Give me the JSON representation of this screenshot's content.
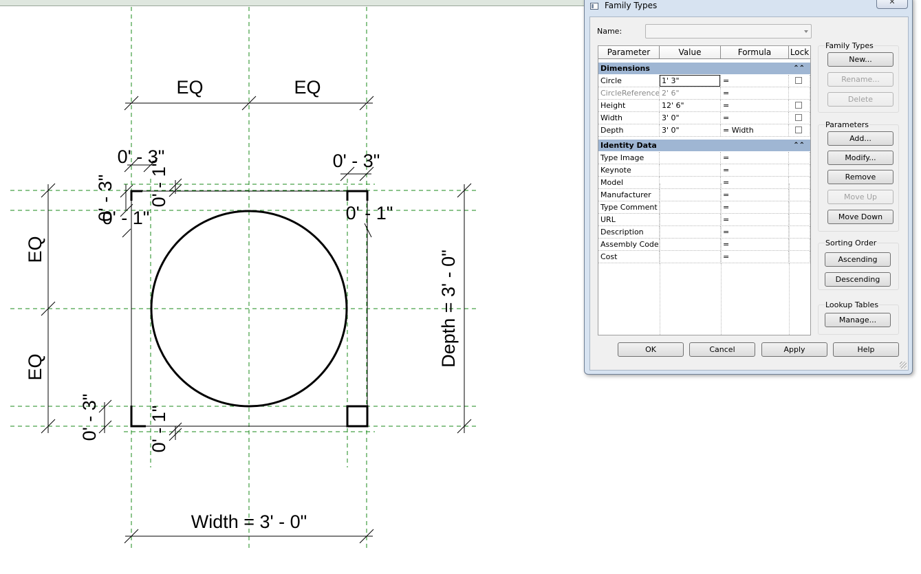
{
  "drawing": {
    "dim_labels": {
      "eq_top_left": "EQ",
      "eq_top_right": "EQ",
      "eq_left_top": "EQ",
      "eq_left_bottom": "EQ",
      "offset_top_left": "0' - 3\"",
      "offset_top_right": "0' - 3\"",
      "offset_left_top": "0' - 3\"",
      "offset_left_small": "0' - 1\"",
      "offset_vert_top_left": "0' - 1\"",
      "offset_right_small": "0' - 1\"",
      "offset_bottom_left": "0' - 3\"",
      "offset_bottom_vert": "0' - 1\"",
      "depth": "Depth = 3' - 0\"",
      "width": "Width = 3' - 0\""
    },
    "colors": {
      "reference_plane": "#1a8a1a",
      "geometry": "#000000"
    }
  },
  "dialog": {
    "title": "Family Types",
    "close_icon": "close-icon",
    "name_label": "Name:",
    "name_value": "",
    "grid": {
      "headers": [
        "Parameter",
        "Value",
        "Formula",
        "Lock"
      ],
      "groups": [
        {
          "label": "Dimensions",
          "collapse_icon": "double-chevron-up-icon",
          "rows": [
            {
              "param": "Circle",
              "value": "1'  3\"",
              "formula": "=",
              "lock": true
            },
            {
              "param": "CircleReference",
              "value": "2'  6\"",
              "formula": "=",
              "lock": false
            },
            {
              "param": "Height",
              "value": "12'  6\"",
              "formula": "=",
              "lock": true
            },
            {
              "param": "Width",
              "value": "3'  0\"",
              "formula": "=",
              "lock": true
            },
            {
              "param": "Depth",
              "value": "3'  0\"",
              "formula": "= Width",
              "lock": true
            }
          ]
        },
        {
          "label": "Identity Data",
          "collapse_icon": "double-chevron-up-icon",
          "rows": [
            {
              "param": "Type Image",
              "value": "",
              "formula": "="
            },
            {
              "param": "Keynote",
              "value": "",
              "formula": "="
            },
            {
              "param": "Model",
              "value": "",
              "formula": "="
            },
            {
              "param": "Manufacturer",
              "value": "",
              "formula": "="
            },
            {
              "param": "Type Comment",
              "value": "",
              "formula": "="
            },
            {
              "param": "URL",
              "value": "",
              "formula": "="
            },
            {
              "param": "Description",
              "value": "",
              "formula": "="
            },
            {
              "param": "Assembly Code",
              "value": "",
              "formula": "="
            },
            {
              "param": "Cost",
              "value": "",
              "formula": "="
            }
          ]
        }
      ]
    },
    "family_types": {
      "title": "Family Types",
      "new": "New...",
      "rename": "Rename...",
      "delete": "Delete"
    },
    "parameters": {
      "title": "Parameters",
      "add": "Add...",
      "modify": "Modify...",
      "remove": "Remove",
      "move_up": "Move Up",
      "move_down": "Move Down"
    },
    "sorting": {
      "title": "Sorting Order",
      "ascending": "Ascending",
      "descending": "Descending"
    },
    "lookup": {
      "title": "Lookup Tables",
      "manage": "Manage..."
    },
    "footer": {
      "ok": "OK",
      "cancel": "Cancel",
      "apply": "Apply",
      "help": "Help"
    }
  }
}
